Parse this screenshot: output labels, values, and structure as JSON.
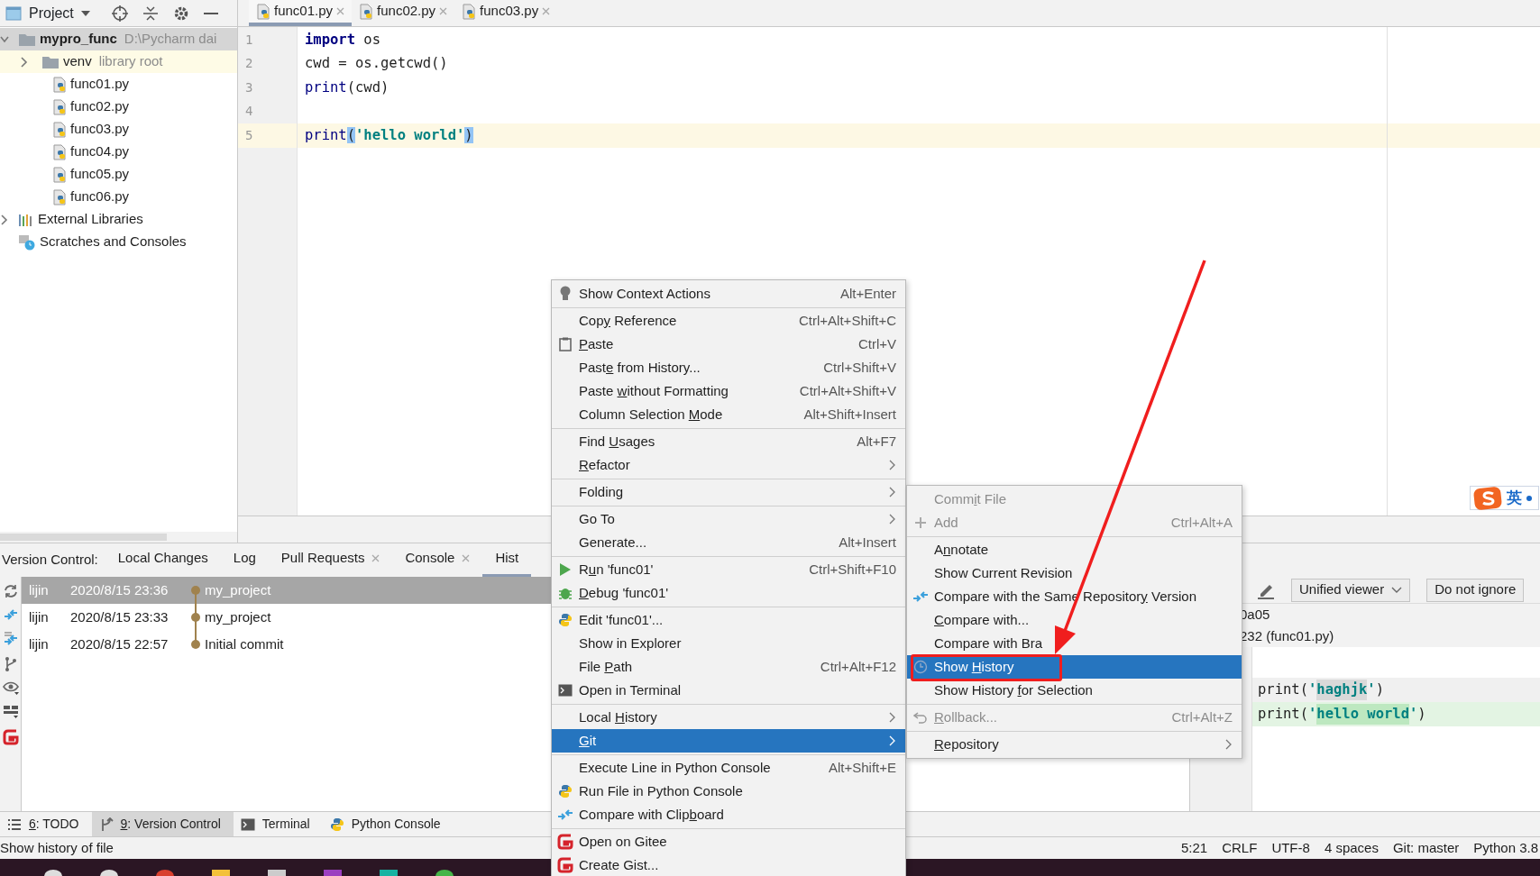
{
  "project_panel": {
    "title": "Project",
    "tree": [
      {
        "label": "mypro_func",
        "hint": "D:\\Pycharm  dai",
        "kind": "project",
        "expanded": true,
        "selected": true,
        "children": [
          {
            "label": "venv",
            "hint": "library root",
            "kind": "library",
            "expanded": false,
            "selected": false
          },
          {
            "label": "func01.py",
            "kind": "file",
            "selected": false
          },
          {
            "label": "func02.py",
            "kind": "file",
            "selected": false
          },
          {
            "label": "func03.py",
            "kind": "file",
            "selected": false
          },
          {
            "label": "func04.py",
            "kind": "file",
            "selected": false
          },
          {
            "label": "func05.py",
            "kind": "file",
            "selected": false
          },
          {
            "label": "func06.py",
            "kind": "file",
            "selected": false
          }
        ]
      },
      {
        "label": "External Libraries",
        "kind": "libraries",
        "expanded": false,
        "selected": false
      },
      {
        "label": "Scratches and Consoles",
        "kind": "scratches",
        "selected": false
      }
    ]
  },
  "editor_tabs": [
    {
      "label": "func01.py",
      "selected": true
    },
    {
      "label": "func02.py",
      "selected": false
    },
    {
      "label": "func03.py",
      "selected": false
    }
  ],
  "code_lines": [
    {
      "number": "1",
      "current": false,
      "tokens": [
        {
          "kind": "keyword",
          "text": "import"
        },
        {
          "kind": "plain",
          "text": " os"
        }
      ]
    },
    {
      "number": "2",
      "current": false,
      "tokens": [
        {
          "kind": "plain",
          "text": "cwd = os.getcwd()"
        }
      ]
    },
    {
      "number": "3",
      "current": false,
      "tokens": [
        {
          "kind": "builtin",
          "text": "print"
        },
        {
          "kind": "plain",
          "text": "(cwd)"
        }
      ]
    },
    {
      "number": "4",
      "current": false
    },
    {
      "number": "5",
      "current": true,
      "tokens": [
        {
          "kind": "builtin",
          "text": "print"
        },
        {
          "kind": "match",
          "text": "("
        },
        {
          "kind": "string",
          "text": "'hello world'"
        },
        {
          "kind": "match",
          "text": ")"
        }
      ]
    }
  ],
  "ime": {
    "mode": "英"
  },
  "version_control": {
    "label": "Version Control:",
    "tabs": [
      {
        "label": "Local Changes",
        "closable": false,
        "selected": false
      },
      {
        "label": "Log",
        "closable": false,
        "selected": false
      },
      {
        "label": "Pull Requests",
        "closable": true,
        "selected": false
      },
      {
        "label": "Console",
        "closable": true,
        "selected": false
      },
      {
        "label": "Hist",
        "closable": false,
        "selected": true
      }
    ],
    "commits": [
      {
        "author": "lijin",
        "date": "2020/8/15 23:36",
        "message": "my_project",
        "selected": true
      },
      {
        "author": "lijin",
        "date": "2020/8/15 23:33",
        "message": "my_project",
        "selected": false
      },
      {
        "author": "lijin",
        "date": "2020/8/15 22:57",
        "message": "Initial commit",
        "selected": false
      }
    ],
    "diff": {
      "viewer": "Unified viewer",
      "ignore": "Do not ignore",
      "header": [
        "0a05",
        "232 (func01.py)"
      ],
      "lines": [
        {
          "kind": "removed",
          "tokens": [
            {
              "kind": "plain",
              "text": "print("
            },
            {
              "kind": "string",
              "text": "'"
            },
            {
              "kind": "changed",
              "text": "haghjk"
            },
            {
              "kind": "string",
              "text": "'"
            },
            {
              "kind": "plain",
              "text": ")"
            }
          ]
        },
        {
          "kind": "added",
          "tokens": [
            {
              "kind": "plain",
              "text": "print("
            },
            {
              "kind": "string",
              "text": "'"
            },
            {
              "kind": "changed",
              "text": "hello world"
            },
            {
              "kind": "string",
              "text": "'"
            },
            {
              "kind": "plain",
              "text": ")"
            }
          ]
        }
      ]
    }
  },
  "tool_tabs": [
    {
      "key": "6",
      "label": ": TODO",
      "selected": false
    },
    {
      "key": "9",
      "label": ": Version Control",
      "selected": true
    },
    {
      "label": "Terminal",
      "selected": false
    },
    {
      "label": "Python Console",
      "selected": false
    }
  ],
  "status_bar": {
    "message": "Show history of file",
    "fields": [
      "5:21",
      "CRLF",
      "UTF-8",
      "4 spaces",
      "Git: master",
      "Python 3.8"
    ]
  },
  "context_menu": [
    {
      "label": "Show Context Actions",
      "shortcut": "Alt+Enter"
    },
    {
      "separator": true
    },
    {
      "label_parts": [
        {
          "text": "Cop"
        },
        {
          "text": "y",
          "underlined": true
        },
        {
          "text": " Reference"
        }
      ],
      "shortcut": "Ctrl+Alt+Shift+C"
    },
    {
      "label_parts": [
        {
          "text": "P",
          "underlined": true
        },
        {
          "text": "aste"
        }
      ],
      "shortcut": "Ctrl+V"
    },
    {
      "label_parts": [
        {
          "text": "Past"
        },
        {
          "text": "e",
          "underlined": true
        },
        {
          "text": " from History..."
        }
      ],
      "shortcut": "Ctrl+Shift+V"
    },
    {
      "label_parts": [
        {
          "text": "Paste "
        },
        {
          "text": "w",
          "underlined": true
        },
        {
          "text": "ithout Formatting"
        }
      ],
      "shortcut": "Ctrl+Alt+Shift+V"
    },
    {
      "label_parts": [
        {
          "text": "Column Selection "
        },
        {
          "text": "M",
          "underlined": true
        },
        {
          "text": "ode"
        }
      ],
      "shortcut": "Alt+Shift+Insert"
    },
    {
      "separator": true
    },
    {
      "label_parts": [
        {
          "text": "Find "
        },
        {
          "text": "U",
          "underlined": true
        },
        {
          "text": "sages"
        }
      ],
      "shortcut": "Alt+F7"
    },
    {
      "label_parts": [
        {
          "text": "R",
          "underlined": true
        },
        {
          "text": "efactor"
        }
      ],
      "submenu": true
    },
    {
      "separator": true
    },
    {
      "label": "Folding",
      "submenu": true
    },
    {
      "separator": true
    },
    {
      "label": "Go To",
      "submenu": true
    },
    {
      "label": "Generate...",
      "shortcut": "Alt+Insert"
    },
    {
      "separator": true
    },
    {
      "label_parts": [
        {
          "text": "R"
        },
        {
          "text": "u",
          "underlined": true
        },
        {
          "text": "n 'func01'"
        }
      ],
      "shortcut": "Ctrl+Shift+F10"
    },
    {
      "label_parts": [
        {
          "text": "D",
          "underlined": true
        },
        {
          "text": "ebug 'func01'"
        }
      ]
    },
    {
      "separator": true
    },
    {
      "label": "Edit 'func01'..."
    },
    {
      "label": "Show in Explorer"
    },
    {
      "label_parts": [
        {
          "text": "File "
        },
        {
          "text": "P",
          "underlined": true
        },
        {
          "text": "ath"
        }
      ],
      "shortcut": "Ctrl+Alt+F12"
    },
    {
      "label": "Open in Terminal"
    },
    {
      "separator": true
    },
    {
      "label_parts": [
        {
          "text": "Local "
        },
        {
          "text": "H",
          "underlined": true
        },
        {
          "text": "istory"
        }
      ],
      "submenu": true
    },
    {
      "label_parts": [
        {
          "text": "G",
          "underlined": true
        },
        {
          "text": "it"
        }
      ],
      "submenu": true,
      "selected": true
    },
    {
      "separator": true
    },
    {
      "label": "Execute Line in Python Console",
      "shortcut": "Alt+Shift+E"
    },
    {
      "label": "Run File in Python Console"
    },
    {
      "label_parts": [
        {
          "text": "Compare with Clip"
        },
        {
          "text": "b",
          "underlined": true
        },
        {
          "text": "oard"
        }
      ]
    },
    {
      "separator": true
    },
    {
      "label": "Open on Gitee"
    },
    {
      "label": "Create Gist..."
    }
  ],
  "git_submenu": [
    {
      "label_parts": [
        {
          "text": "Comm"
        },
        {
          "text": "i",
          "underlined": true
        },
        {
          "text": "t File"
        }
      ],
      "disabled": true
    },
    {
      "label": "Add",
      "shortcut": "Ctrl+Alt+A",
      "disabled": true
    },
    {
      "separator": true
    },
    {
      "label_parts": [
        {
          "text": "A"
        },
        {
          "text": "n",
          "underlined": true
        },
        {
          "text": "notate"
        }
      ]
    },
    {
      "label": "Show Current Revision"
    },
    {
      "label_parts": [
        {
          "text": "Compare with the Same Repositor"
        },
        {
          "text": "y",
          "underlined": true
        },
        {
          "text": " Version"
        }
      ]
    },
    {
      "label_parts": [
        {
          "text": "C",
          "underlined": true
        },
        {
          "text": "ompare with..."
        }
      ]
    },
    {
      "label": "Compare with Bra"
    },
    {
      "label_parts": [
        {
          "text": "Show "
        },
        {
          "text": "H",
          "underlined": true
        },
        {
          "text": "istory"
        }
      ],
      "selected": true,
      "annotated": true
    },
    {
      "label_parts": [
        {
          "text": "Show History "
        },
        {
          "text": "f",
          "underlined": true
        },
        {
          "text": "or Selection"
        }
      ]
    },
    {
      "separator": true
    },
    {
      "label_parts": [
        {
          "text": "R",
          "underlined": true
        },
        {
          "text": "ollback..."
        }
      ],
      "shortcut": "Ctrl+Alt+Z",
      "disabled": true
    },
    {
      "separator": true
    },
    {
      "label_parts": [
        {
          "text": "R",
          "underlined": true
        },
        {
          "text": "epository"
        }
      ],
      "submenu": true
    }
  ]
}
